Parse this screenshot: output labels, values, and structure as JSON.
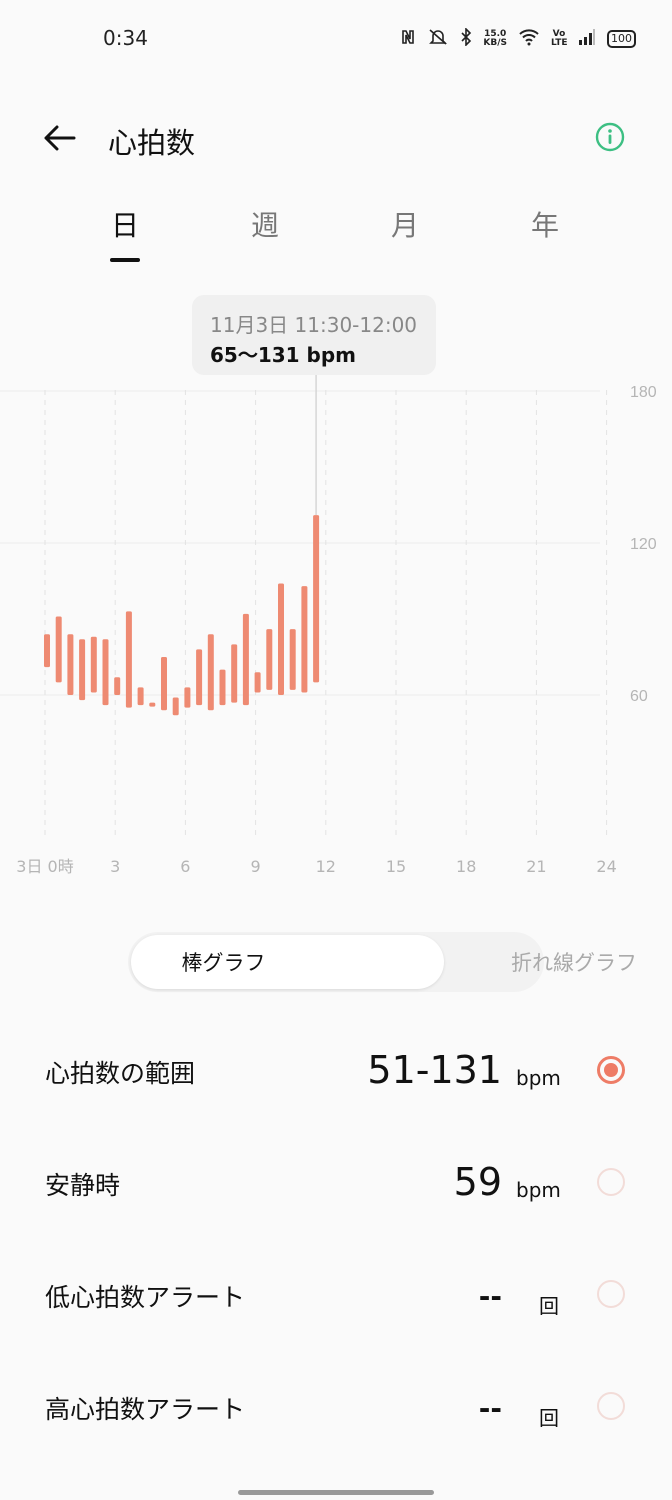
{
  "status_bar": {
    "time": "0:34",
    "net_speed_top": "15.0",
    "net_speed_bottom": "KB/S",
    "volte": "Vo LTE",
    "battery": "100",
    "icons": [
      "nfc-icon",
      "mute-icon",
      "bluetooth-icon",
      "wifi-icon",
      "signal-icon",
      "battery-icon"
    ]
  },
  "header": {
    "title": "心拍数",
    "back_icon": "arrow-left-icon",
    "info_icon": "info-circle-icon",
    "accent": "#3dbf83"
  },
  "tabs": [
    {
      "label": "日",
      "active": true
    },
    {
      "label": "週",
      "active": false
    },
    {
      "label": "月",
      "active": false
    },
    {
      "label": "年",
      "active": false
    }
  ],
  "tooltip": {
    "date": "11月3日 11:30-12:00",
    "value": "65〜131 bpm"
  },
  "chart_data": {
    "type": "bar",
    "range_bars": true,
    "color": "#ee8a72",
    "x_tick_labels": [
      "3日 0時",
      "3",
      "6",
      "9",
      "12",
      "15",
      "18",
      "21",
      "24"
    ],
    "y_tick_labels": [
      "180",
      "120",
      "60"
    ],
    "ylim": [
      0,
      180
    ],
    "xlim_hours": [
      0,
      24
    ],
    "grid": true,
    "series": [
      {
        "x_hours": [
          0,
          0.5,
          1,
          1.5,
          2,
          2.5,
          3,
          3.5,
          4,
          4.5,
          5,
          5.5,
          6,
          6.5,
          7,
          7.5,
          8,
          8.5,
          9,
          9.5,
          10,
          10.5,
          11,
          11.5
        ],
        "low": [
          71,
          65,
          60,
          58,
          61,
          56,
          60,
          55,
          56,
          56,
          54,
          52,
          55,
          56,
          54,
          56,
          57,
          56,
          61,
          62,
          60,
          62,
          61,
          65
        ],
        "high": [
          84,
          91,
          84,
          82,
          83,
          82,
          67,
          93,
          63,
          57,
          75,
          59,
          63,
          78,
          84,
          70,
          80,
          92,
          69,
          86,
          104,
          86,
          103,
          131
        ]
      }
    ],
    "selected_index": 23
  },
  "chart_toggle": {
    "bar_label": "棒グラフ",
    "line_label": "折れ線グラフ",
    "selected": "bar"
  },
  "metrics": [
    {
      "label": "心拍数の範囲",
      "value": "51-131",
      "unit": "bpm",
      "selected": true
    },
    {
      "label": "安静時",
      "value": "59",
      "unit": "bpm",
      "selected": false
    },
    {
      "label": "低心拍数アラート",
      "value": "--",
      "unit": "回",
      "selected": false
    },
    {
      "label": "高心拍数アラート",
      "value": "--",
      "unit": "回",
      "selected": false
    }
  ]
}
